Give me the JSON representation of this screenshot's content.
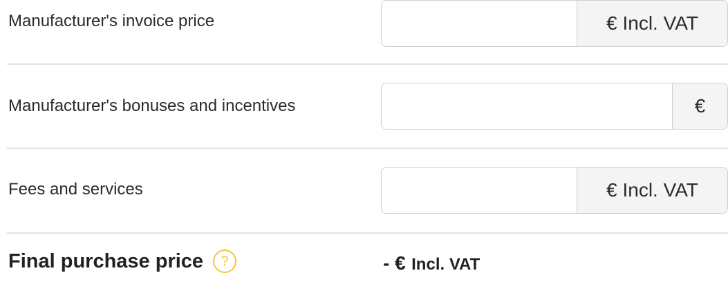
{
  "rows": [
    {
      "label": "Manufacturer's invoice price",
      "input_value": "",
      "addon": "€ Incl. VAT"
    },
    {
      "label": "Manufacturer's bonuses and incentives",
      "input_value": "",
      "addon": "€"
    },
    {
      "label": "Fees and services",
      "input_value": "",
      "addon": "€ Incl. VAT"
    }
  ],
  "summary": {
    "label": "Final purchase price",
    "help_icon": "question-circle-icon",
    "help_glyph": "?",
    "amount": "- €",
    "unit": "Incl. VAT"
  },
  "colors": {
    "help_accent": "#f2c73a",
    "border": "#cfcfcf",
    "addon_background": "#f4f4f4"
  }
}
